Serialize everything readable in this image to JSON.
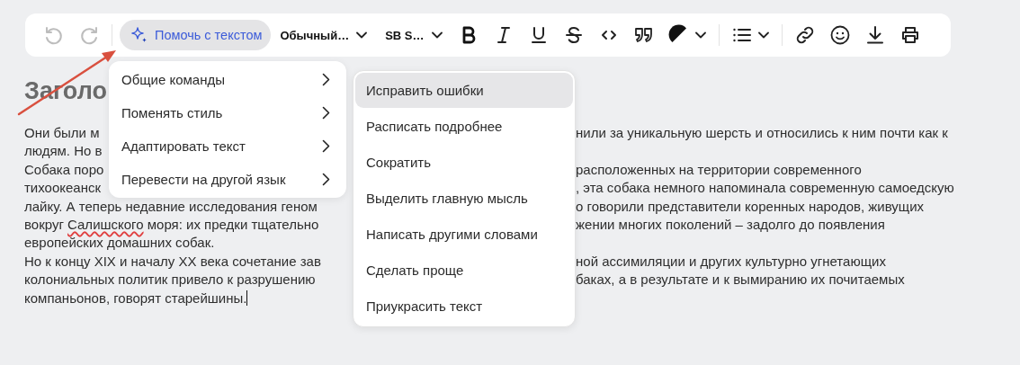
{
  "toolbar": {
    "undo_enabled": false,
    "redo_enabled": false,
    "ai_button": {
      "label": "Помочь с текстом",
      "selected": true
    },
    "style_dropdown": {
      "label": "Обычный…"
    },
    "font_dropdown": {
      "label": "SB S…"
    }
  },
  "document": {
    "heading": "Заголо",
    "lines": [
      {
        "left": [
          {
            "text": "Они были м",
            "misspelled": false
          }
        ],
        "right": "нили за уникальную шерсть и относились к ним почти как к"
      },
      {
        "left": [
          {
            "text": "людям. Но в",
            "misspelled": false
          }
        ]
      },
      {
        "left": [
          {
            "text": "Собака поро",
            "misspelled": false
          }
        ],
        "right": "расположенных на территории современного"
      },
      {
        "left": [
          {
            "text": "тихоокеанск",
            "misspelled": false
          }
        ],
        "right": ", эта собака немного напоминала современную самоедскую"
      },
      {
        "left": [
          {
            "text": "лайку. А теперь недавние исследования геном",
            "misspelled": false
          }
        ],
        "right": "о говорили представители коренных народов, живущих"
      },
      {
        "left": [
          {
            "text": "вокруг ",
            "misspelled": false
          },
          {
            "text": "Салишского",
            "misspelled": true
          },
          {
            "text": " моря: их предки тщательно",
            "misspelled": false
          }
        ],
        "right": "жении многих поколений – задолго до появления"
      },
      {
        "left": [
          {
            "text": "европейских домашних собак.",
            "misspelled": false
          }
        ]
      },
      {
        "left": [
          {
            "text": "Но к концу XIX и началу XX века сочетание зав",
            "misspelled": false
          }
        ],
        "right": "ной ассимиляции и других культурно угнетающих"
      },
      {
        "left": [
          {
            "text": "колониальных политик привело к разрушению",
            "misspelled": false
          }
        ],
        "right": "баках, а в результате и к вымиранию их почитаемых"
      },
      {
        "left": [
          {
            "text": "компаньонов, говорят старейшины.",
            "misspelled": false
          }
        ]
      }
    ],
    "cursor_at_end": true
  },
  "menu": {
    "items": [
      {
        "label": "Общие команды",
        "has_submenu": true
      },
      {
        "label": "Поменять стиль",
        "has_submenu": true
      },
      {
        "label": "Адаптировать текст",
        "has_submenu": true
      },
      {
        "label": "Перевести на другой язык",
        "has_submenu": true
      }
    ]
  },
  "submenu": {
    "items": [
      {
        "label": "Исправить ошибки",
        "selected": true
      },
      {
        "label": "Расписать подробнее",
        "selected": false
      },
      {
        "label": "Сократить",
        "selected": false
      },
      {
        "label": "Выделить главную мысль",
        "selected": false
      },
      {
        "label": "Написать другими словами",
        "selected": false
      },
      {
        "label": "Сделать проще",
        "selected": false
      },
      {
        "label": "Приукрасить текст",
        "selected": false
      }
    ]
  }
}
